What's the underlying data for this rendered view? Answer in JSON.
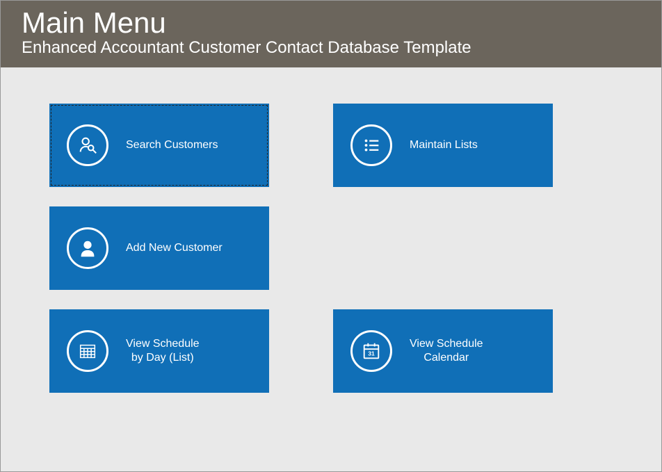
{
  "header": {
    "title": "Main Menu",
    "subtitle": "Enhanced Accountant Customer Contact Database Template"
  },
  "tiles": {
    "search_customers": "Search Customers",
    "add_new_customer": "Add New Customer",
    "view_schedule_list": "View Schedule\nby Day (List)",
    "maintain_lists": "Maintain Lists",
    "view_schedule_calendar": "View Schedule\nCalendar"
  },
  "colors": {
    "tile_bg": "#106fb7",
    "header_bg": "#6b655c",
    "page_bg": "#e9e9e9"
  }
}
